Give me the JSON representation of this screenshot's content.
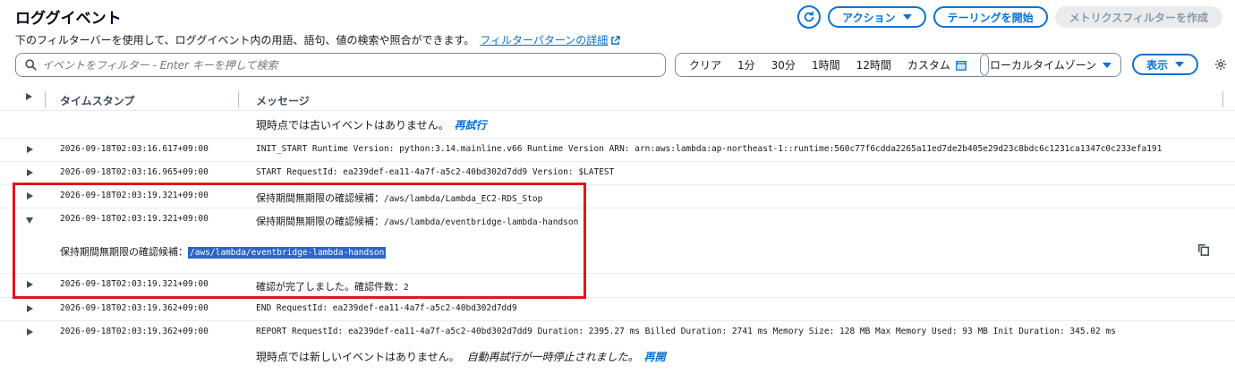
{
  "header": {
    "title": "ロググイベント",
    "description": "下のフィルターバーを使用して、ロググイベント内の用語、語句、値の検索や照合ができます。",
    "filter_pattern_link": "フィルターパターンの詳細"
  },
  "toolbar": {
    "actions_label": "アクション",
    "tail_label": "テーリングを開始",
    "metric_filter_label": "メトリクスフィルターを作成"
  },
  "filter": {
    "placeholder": "イベントをフィルター - Enter キーを押して検索",
    "time_options": [
      "クリア",
      "1分",
      "30分",
      "1時間",
      "12時間"
    ],
    "custom_label": "カスタム",
    "timezone": "ローカルタイムゾーン",
    "display_label": "表示"
  },
  "table": {
    "col_timestamp": "タイムスタンプ",
    "col_message": "メッセージ"
  },
  "notice_top": {
    "text": "現時点では古いイベントはありません。",
    "link": "再試行"
  },
  "notice_bottom": {
    "text": "現時点では新しいイベントはありません。",
    "paused": "自動再試行が一時停止されました。",
    "link": "再開"
  },
  "rows": [
    {
      "timestamp": "2026-09-18T02:03:16.617+09:00",
      "message": "INIT_START Runtime Version: python:3.14.mainline.v66 Runtime Version ARN: arn:aws:lambda:ap-northeast-1::runtime:560c77f6cdda2265a11ed7de2b405e29d23c8bdc6c1231ca1347c0c233efa191",
      "expanded": false
    },
    {
      "timestamp": "2026-09-18T02:03:16.965+09:00",
      "message": "START RequestId: ea239def-ea11-4a7f-a5c2-40bd302d7dd9 Version: $LATEST",
      "expanded": false
    },
    {
      "timestamp": "2026-09-18T02:03:19.321+09:00",
      "message_jp": "保持期間無期限の確認候補：",
      "message": "/aws/lambda/Lambda_EC2-RDS_Stop",
      "expanded": false
    },
    {
      "timestamp": "2026-09-18T02:03:19.321+09:00",
      "message_jp": "保持期間無期限の確認候補：",
      "message": "/aws/lambda/eventbridge-lambda-handson",
      "expanded": true
    },
    {
      "timestamp": "2026-09-18T02:03:19.321+09:00",
      "message_jp": "確認が完了しました。確認件数：",
      "message": "2",
      "expanded": false
    },
    {
      "timestamp": "2026-09-18T02:03:19.362+09:00",
      "message": "END RequestId: ea239def-ea11-4a7f-a5c2-40bd302d7dd9",
      "expanded": false
    },
    {
      "timestamp": "2026-09-18T02:03:19.362+09:00",
      "message": "REPORT RequestId: ea239def-ea11-4a7f-a5c2-40bd302d7dd9 Duration: 2395.27 ms Billed Duration: 2741 ms Memory Size: 128 MB Max Memory Used: 93 MB Init Duration: 345.02 ms",
      "expanded": false
    }
  ],
  "expanded_detail": {
    "label": "保持期間無期限の確認候補：",
    "selected_text": "/aws/lambda/eventbridge-lambda-handson"
  },
  "colors": {
    "accent": "#0972d3",
    "highlight_box": "#e0161e",
    "selection": "#2d65c9"
  }
}
